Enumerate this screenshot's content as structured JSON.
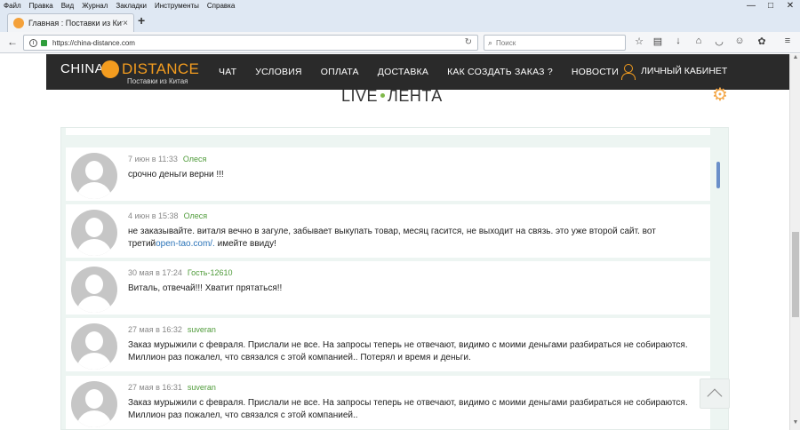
{
  "browser": {
    "menu": [
      "Файл",
      "Правка",
      "Вид",
      "Журнал",
      "Закладки",
      "Инструменты",
      "Справка"
    ],
    "tab_title": "Главная : Поставки из Китая",
    "tab_close": "×",
    "new_tab": "+",
    "url": "https://china-distance.com",
    "search_placeholder": "Поиск",
    "window_controls": [
      "—",
      "□",
      "✕"
    ],
    "icons": {
      "back": "←",
      "info": "i",
      "reload": "↻",
      "search": "⌕",
      "bookmark": "☆",
      "library": "▤",
      "download": "↓",
      "home": "⌂",
      "pocket": "◡",
      "sync": "☺",
      "ext": "✿",
      "menu": "≡"
    }
  },
  "site": {
    "logo_china": "CHINA",
    "logo_distance": "DISTANCE",
    "logo_tagline": "Поставки из Китая",
    "nav": [
      "ЧАТ",
      "УСЛОВИЯ",
      "ОПЛАТА",
      "ДОСТАВКА",
      "КАК СОЗДАТЬ ЗАКАЗ ?",
      "НОВОСТИ"
    ],
    "cabinet": "ЛИЧНЫЙ КАБИНЕТ",
    "brand_color": "#f39c1f"
  },
  "feed": {
    "title_left": "LIVE",
    "title_right": "ЛЕНТА",
    "settings_icon": "⚙",
    "comments": [
      {
        "date": "7 июн в 11:33",
        "author": "Олеся",
        "text": "срочно деньги верни !!!",
        "link": "",
        "text_after": ""
      },
      {
        "date": "4 июн в 15:38",
        "author": "Олеся",
        "text": "не заказывайте. виталя вечно в загуле, забывает выкупать товар, месяц гасится, не выходит на связь. это уже второй сайт. вот третий",
        "link": "open-tao.com/.",
        "text_after": " имейте ввиду!"
      },
      {
        "date": "30 мая в 17:24",
        "author": "Гость-12610",
        "text": "Виталь, отвечай!!! Хватит прятаться!!",
        "link": "",
        "text_after": ""
      },
      {
        "date": "27 мая в 16:32",
        "author": "suveran",
        "text": "Заказ мурыжили с февраля. Прислали не все. На запросы теперь не отвечают, видимо с моими деньгами разбираться не собираются. Миллион раз пожалел, что связался с этой компанией.. Потерял и время и деньги.",
        "link": "",
        "text_after": ""
      },
      {
        "date": "27 мая в 16:31",
        "author": "suveran",
        "text": "Заказ мурыжили с февраля. Прислали не все. На запросы теперь не отвечают, видимо с моими деньгами разбираться не собираются. Миллион раз пожалел, что связался с этой компанией..",
        "link": "",
        "text_after": ""
      }
    ]
  }
}
